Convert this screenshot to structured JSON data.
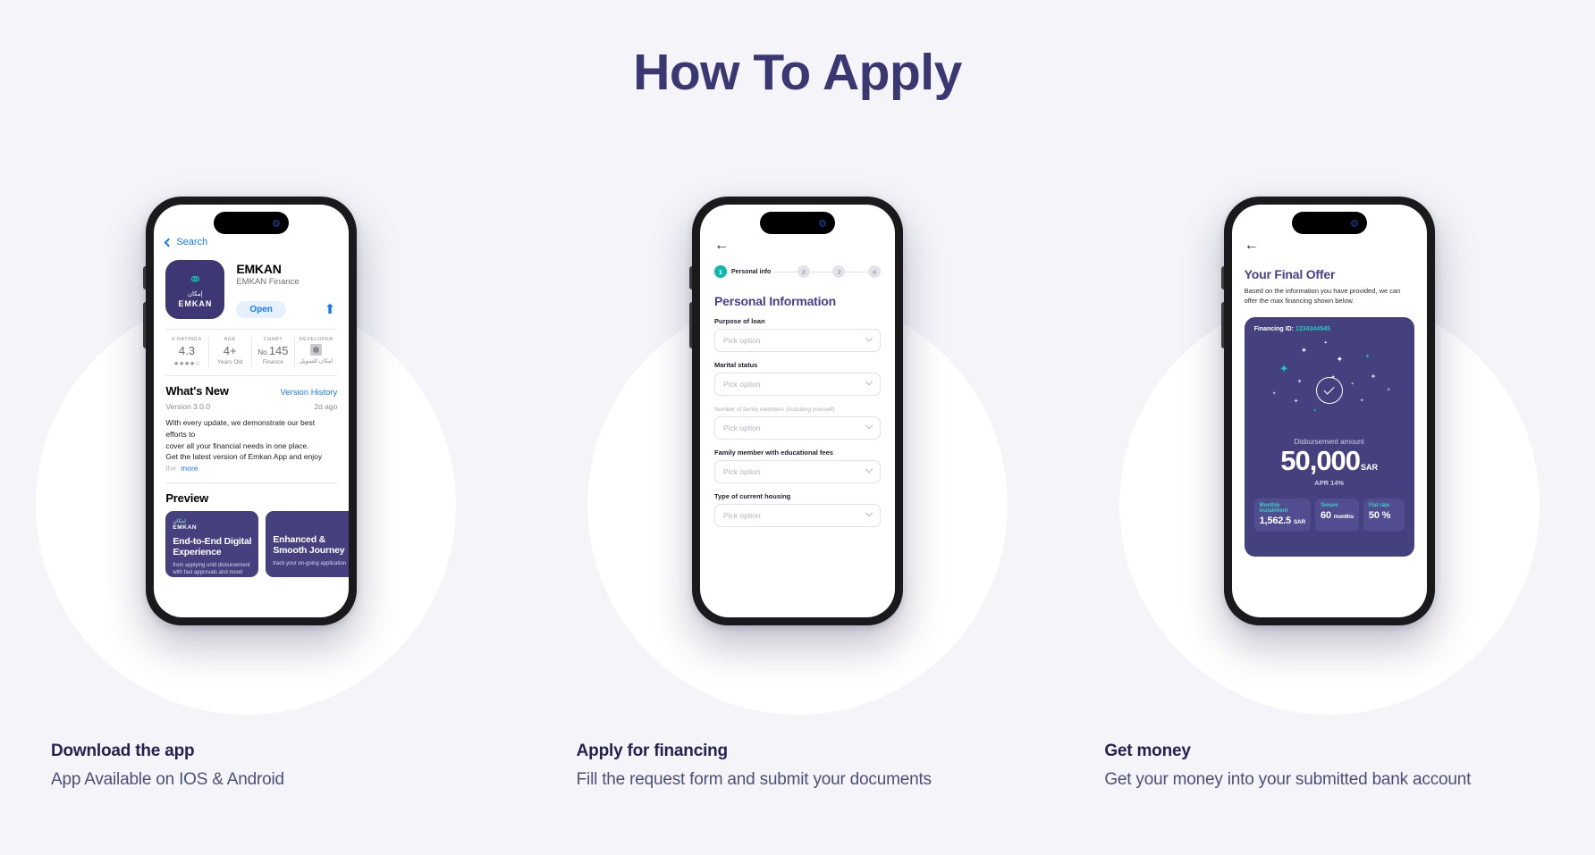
{
  "header": {
    "title": "How To Apply"
  },
  "steps": [
    {
      "caption_title": "Download the app",
      "caption_text": "App Available on IOS & Android",
      "phone": {
        "back_label": "Search",
        "app_name": "EMKAN",
        "app_subtitle": "EMKAN Finance",
        "icon_arabic": "إمكان",
        "icon_latin": "EMKAN",
        "open_button": "Open",
        "share_icon": "share-icon",
        "stats": [
          {
            "cap": "6 RATINGS",
            "value": "4.3",
            "sub": "",
            "stars": "★★★★☆"
          },
          {
            "cap": "AGE",
            "value": "4+",
            "sub": "Years Old"
          },
          {
            "cap": "CHART",
            "value_prefix": "No.",
            "value": "145",
            "sub": "Finance"
          },
          {
            "cap": "DEVELOPER",
            "value": "",
            "sub": "امكان للتمويل"
          }
        ],
        "whats_new": {
          "title": "What's New",
          "link": "Version History",
          "version": "Version 3.0.0",
          "date": "2d ago",
          "line1": "With every update, we demonstrate our best efforts to",
          "line2": "cover all your financial needs in one place.",
          "line3": "Get the latest version of Emkan App and enjoy ",
          "line3_fade": "the",
          "more": "more"
        },
        "preview": {
          "title": "Preview",
          "cards": [
            {
              "logo_ar": "إمكان",
              "logo_en": "EMKAN",
              "heading": "End-to-End Digital Experience",
              "text": "from applying until disbursement with fast approvals and more!"
            },
            {
              "heading": "Enhanced & Smooth Journey",
              "text": "track your on-going application"
            }
          ]
        }
      }
    },
    {
      "caption_title": "Apply for financing",
      "caption_text": "Fill the request form and submit your documents",
      "phone": {
        "back_icon": "arrow-left-icon",
        "stepper": [
          {
            "num": "1",
            "label": "Personal  info",
            "active": true
          },
          {
            "num": "2",
            "label": "",
            "active": false
          },
          {
            "num": "3",
            "label": "",
            "active": false
          },
          {
            "num": "4",
            "label": "",
            "active": false
          }
        ],
        "form_title": "Personal Information",
        "fields": [
          {
            "label": "Purpose of loan",
            "hint": "",
            "placeholder": "Pick option"
          },
          {
            "label": "Marital status",
            "hint": "",
            "placeholder": "Pick option"
          },
          {
            "label": "Number of family members",
            "hint": "(including yourself)",
            "placeholder": "Pick option"
          },
          {
            "label": "Family member with educational fees",
            "hint": "",
            "placeholder": "Pick option"
          },
          {
            "label": "Type of current housing",
            "hint": "",
            "placeholder": "Pick option"
          }
        ]
      }
    },
    {
      "caption_title": "Get money",
      "caption_text": "Get your money into your submitted bank account",
      "phone": {
        "back_icon": "arrow-left-icon",
        "title": "Your Final Offer",
        "description": "Based on the information you have provided, we can offer the max financing shown below.",
        "financing_id_label": "Financing ID:",
        "financing_id": "1234344545",
        "check_icon": "check-circle-icon",
        "disbursement_label": "Disbursement amount",
        "amount": "50,000",
        "currency": "SAR",
        "apr": "APR  14%",
        "chips": [
          {
            "key": "Monthly installment",
            "value": "1,562.5",
            "unit": "SAR"
          },
          {
            "key": "Tenure",
            "value": "60",
            "unit": "months"
          },
          {
            "key": "Flat rate",
            "value": "50 %",
            "unit": ""
          }
        ]
      }
    }
  ],
  "colors": {
    "page_bg": "#f4f4f9",
    "title": "#3b3773",
    "brand_indigo": "#45417e",
    "teal": "#0cb8ab",
    "ios_blue": "#1579ff"
  }
}
